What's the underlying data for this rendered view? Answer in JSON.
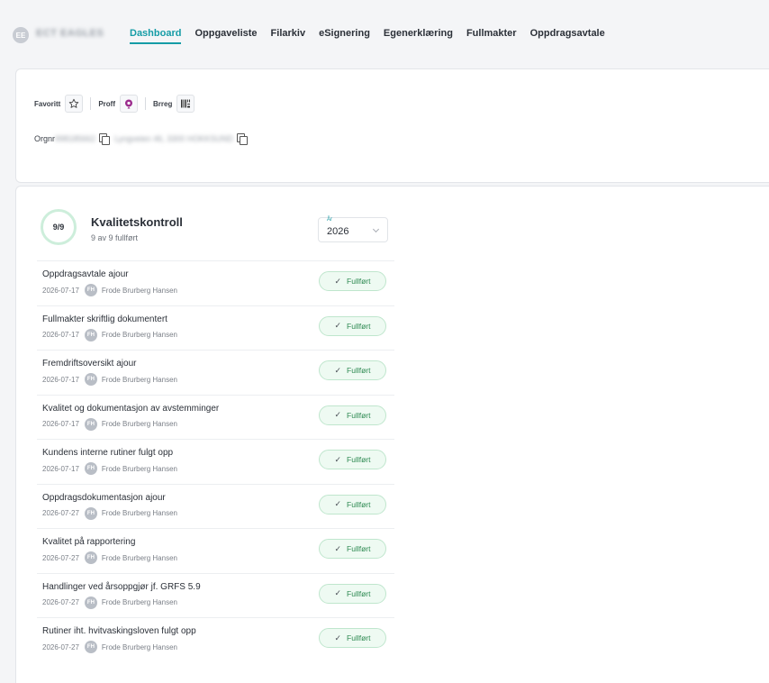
{
  "header": {
    "company_avatar": "EE",
    "company_name": "ECT EAGLES",
    "tabs": [
      {
        "label": "Dashboard",
        "active": true
      },
      {
        "label": "Oppgaveliste"
      },
      {
        "label": "Filarkiv"
      },
      {
        "label": "eSignering"
      },
      {
        "label": "Egenerklæring"
      },
      {
        "label": "Fullmakter"
      },
      {
        "label": "Oppdragsavtale"
      }
    ]
  },
  "info": {
    "favoritt_label": "Favoritt",
    "proff_label": "Proff",
    "brreg_label": "Brreg",
    "orgnr_label": "Orgnr",
    "orgnr_value": "998185662",
    "address": "Lyngveien 46, 3300 HOKKSUND",
    "icons": [
      "star-icon",
      "proff-pin-icon",
      "barcode-icon",
      "copy-icon"
    ]
  },
  "checklist": {
    "progress": "9/9",
    "title": "Kvalitetskontroll",
    "subtitle": "9 av 9 fullført",
    "year_label": "År",
    "year_value": "2026",
    "status_label": "Fullført",
    "accent_color": "#159ca6",
    "success_color": "#2e8a52",
    "items": [
      {
        "title": "Oppdragsavtale ajour",
        "date": "2026-07-17",
        "initials": "FH",
        "user": "Frode Brurberg Hansen"
      },
      {
        "title": "Fullmakter skriftlig dokumentert",
        "date": "2026-07-17",
        "initials": "FH",
        "user": "Frode Brurberg Hansen"
      },
      {
        "title": "Fremdriftsoversikt ajour",
        "date": "2026-07-17",
        "initials": "FH",
        "user": "Frode Brurberg Hansen"
      },
      {
        "title": "Kvalitet og dokumentasjon av avstemminger",
        "date": "2026-07-17",
        "initials": "FH",
        "user": "Frode Brurberg Hansen"
      },
      {
        "title": "Kundens interne rutiner fulgt opp",
        "date": "2026-07-17",
        "initials": "FH",
        "user": "Frode Brurberg Hansen"
      },
      {
        "title": "Oppdragsdokumentasjon ajour",
        "date": "2026-07-27",
        "initials": "FH",
        "user": "Frode Brurberg Hansen"
      },
      {
        "title": "Kvalitet på rapportering",
        "date": "2026-07-27",
        "initials": "FH",
        "user": "Frode Brurberg Hansen"
      },
      {
        "title": "Handlinger ved årsoppgjør jf. GRFS 5.9",
        "date": "2026-07-27",
        "initials": "FH",
        "user": "Frode Brurberg Hansen"
      },
      {
        "title": "Rutiner iht. hvitvaskingsloven fulgt opp",
        "date": "2026-07-27",
        "initials": "FH",
        "user": "Frode Brurberg Hansen"
      }
    ]
  }
}
